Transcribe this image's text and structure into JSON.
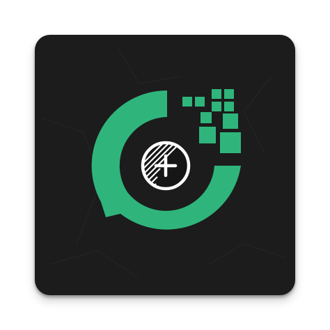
{
  "app_icon": {
    "name": "whatsapp-sticker-maker-icon",
    "colors": {
      "background": "#1c1c1c",
      "brand_green": "#2fb57c",
      "lens_fill": "#161616",
      "lens_stroke": "#ffffff",
      "texture_lines": "#262626"
    },
    "icons": {
      "ring": "chat-bubble-ring-icon",
      "lens": "magnifier-plus-icon",
      "pixels": "pixel-block-icon"
    }
  }
}
